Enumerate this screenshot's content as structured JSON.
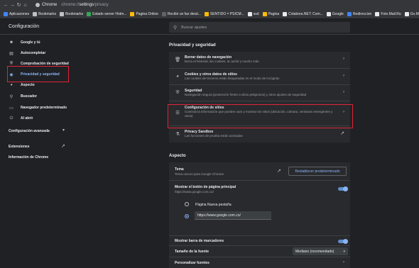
{
  "browser": {
    "tab_label": "Chrome",
    "url_prefix": "chrome://",
    "url_settings": "settings",
    "url_suffix": "/privacy"
  },
  "bookmarks": [
    {
      "label": "Aplicaciones",
      "color": "#4285f4"
    },
    {
      "label": "Bookmarks",
      "color": "#bdc1c6"
    },
    {
      "label": "Bookmarks",
      "color": "#bdc1c6"
    },
    {
      "label": "Estado server Hotm...",
      "color": "#34a853"
    },
    {
      "label": "Pagina Online",
      "color": "#fbbc04"
    },
    {
      "label": "Recibir un fax desd...",
      "color": "#5f6368"
    },
    {
      "label": "SENTIDO = PSICM...",
      "color": "#fbbc04"
    },
    {
      "label": "ssd",
      "color": "#e8eaed"
    },
    {
      "label": "Pagina",
      "color": "#fbbc04"
    },
    {
      "label": "Colabora.NET: Com...",
      "color": "#e8eaed"
    },
    {
      "label": "Google",
      "color": "#e8eaed"
    },
    {
      "label": "Redireccion",
      "color": "#4285f4"
    },
    {
      "label": "Foto.Mail.Ru",
      "color": "#e8eaed"
    },
    {
      "label": "Go.Mail.Ru",
      "color": "#e8eaed"
    }
  ],
  "header": {
    "title": "Configuración",
    "search_placeholder": "Buscar ajustes"
  },
  "sidebar": {
    "items": [
      {
        "label": "Google y tú",
        "icon": "person-icon"
      },
      {
        "label": "Autocompletar",
        "icon": "clipboard-icon"
      },
      {
        "label": "Comprobación de seguridad",
        "icon": "shield-icon"
      },
      {
        "label": "Privacidad y seguridad",
        "icon": "shield-lock-icon"
      },
      {
        "label": "Aspecto",
        "icon": "palette-icon"
      },
      {
        "label": "Buscador",
        "icon": "search-icon"
      },
      {
        "label": "Navegador predeterminado",
        "icon": "browser-icon"
      },
      {
        "label": "Al abrir",
        "icon": "power-icon"
      }
    ],
    "advanced": "Configuración avanzada",
    "extensions": "Extensiones",
    "about": "Información de Chrome"
  },
  "privacy": {
    "section_title": "Privacidad y seguridad",
    "rows": [
      {
        "title": "Borrar datos de navegación",
        "subtitle": "Borra el historial, las cookies, la caché y mucho más",
        "icon": "trash-icon"
      },
      {
        "title": "Cookies y otros datos de sitios",
        "subtitle": "Las cookies de terceros están bloqueadas en el modo de incógnito",
        "icon": "cookie-icon"
      },
      {
        "title": "Seguridad",
        "subtitle": "Navegación segura (protección frente a sitios peligrosos) y otros ajustes de seguridad",
        "icon": "shield-icon"
      },
      {
        "title": "Configuración de sitios",
        "subtitle": "Controla la información que pueden usar y mostrar los sitios (ubicación, cámara, ventanas emergentes y otros)",
        "icon": "sliders-icon"
      },
      {
        "title": "Privacy Sandbox",
        "subtitle": "Las funciones de prueba están activadas",
        "icon": "flask-icon"
      }
    ]
  },
  "appearance": {
    "section_title": "Aspecto",
    "theme_label": "Tema",
    "theme_sub": "Tema oscuro para Google Chrome",
    "reset_button": "Restablecer predeterminado",
    "home_label": "Mostrar el botón de página principal",
    "home_sub": "https://www.google.com.co/",
    "radio_newtab": "Página Nueva pestaña",
    "radio_url_value": "https://www.google.com.co/",
    "bookmarks_bar_label": "Mostrar barra de marcadores",
    "font_size_label": "Tamaño de la fuente",
    "font_size_value": "Mediano (recomendado)",
    "customize_fonts_label": "Personalizar fuentes"
  }
}
